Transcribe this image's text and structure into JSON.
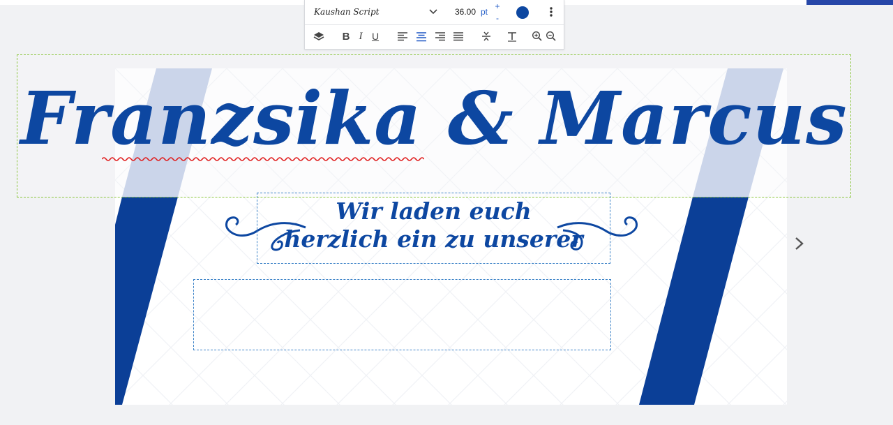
{
  "toolbar": {
    "font_name": "Kaushan Script",
    "font_size": "36.00",
    "font_unit": "pt",
    "increase_label": "+",
    "decrease_label": "-",
    "text_color": "#0d47a1",
    "bold_label": "B",
    "italic_label": "I",
    "underline_label": "U",
    "icons": [
      "layers-icon",
      "bold-icon",
      "italic-icon",
      "underline-icon",
      "align-left-icon",
      "align-center-icon",
      "align-right-icon",
      "align-justify-icon",
      "line-spacing-icon",
      "text-format-icon",
      "zoom-in-icon",
      "zoom-out-icon",
      "more-vertical-icon",
      "chevron-down-icon"
    ]
  },
  "card": {
    "headline": "Franzsika & Marcus",
    "subtitle_line1": "Wir laden euch",
    "subtitle_line2": "herzlich ein zu unserer",
    "body_text": ""
  },
  "colors": {
    "accent": "#0d47a1",
    "stripe_light": "#b4c4e2",
    "stripe_dark": "#0b3f97",
    "selection": "#8cc63e",
    "textbox_border": "#3d83c8",
    "spellcheck": "#e02020"
  }
}
